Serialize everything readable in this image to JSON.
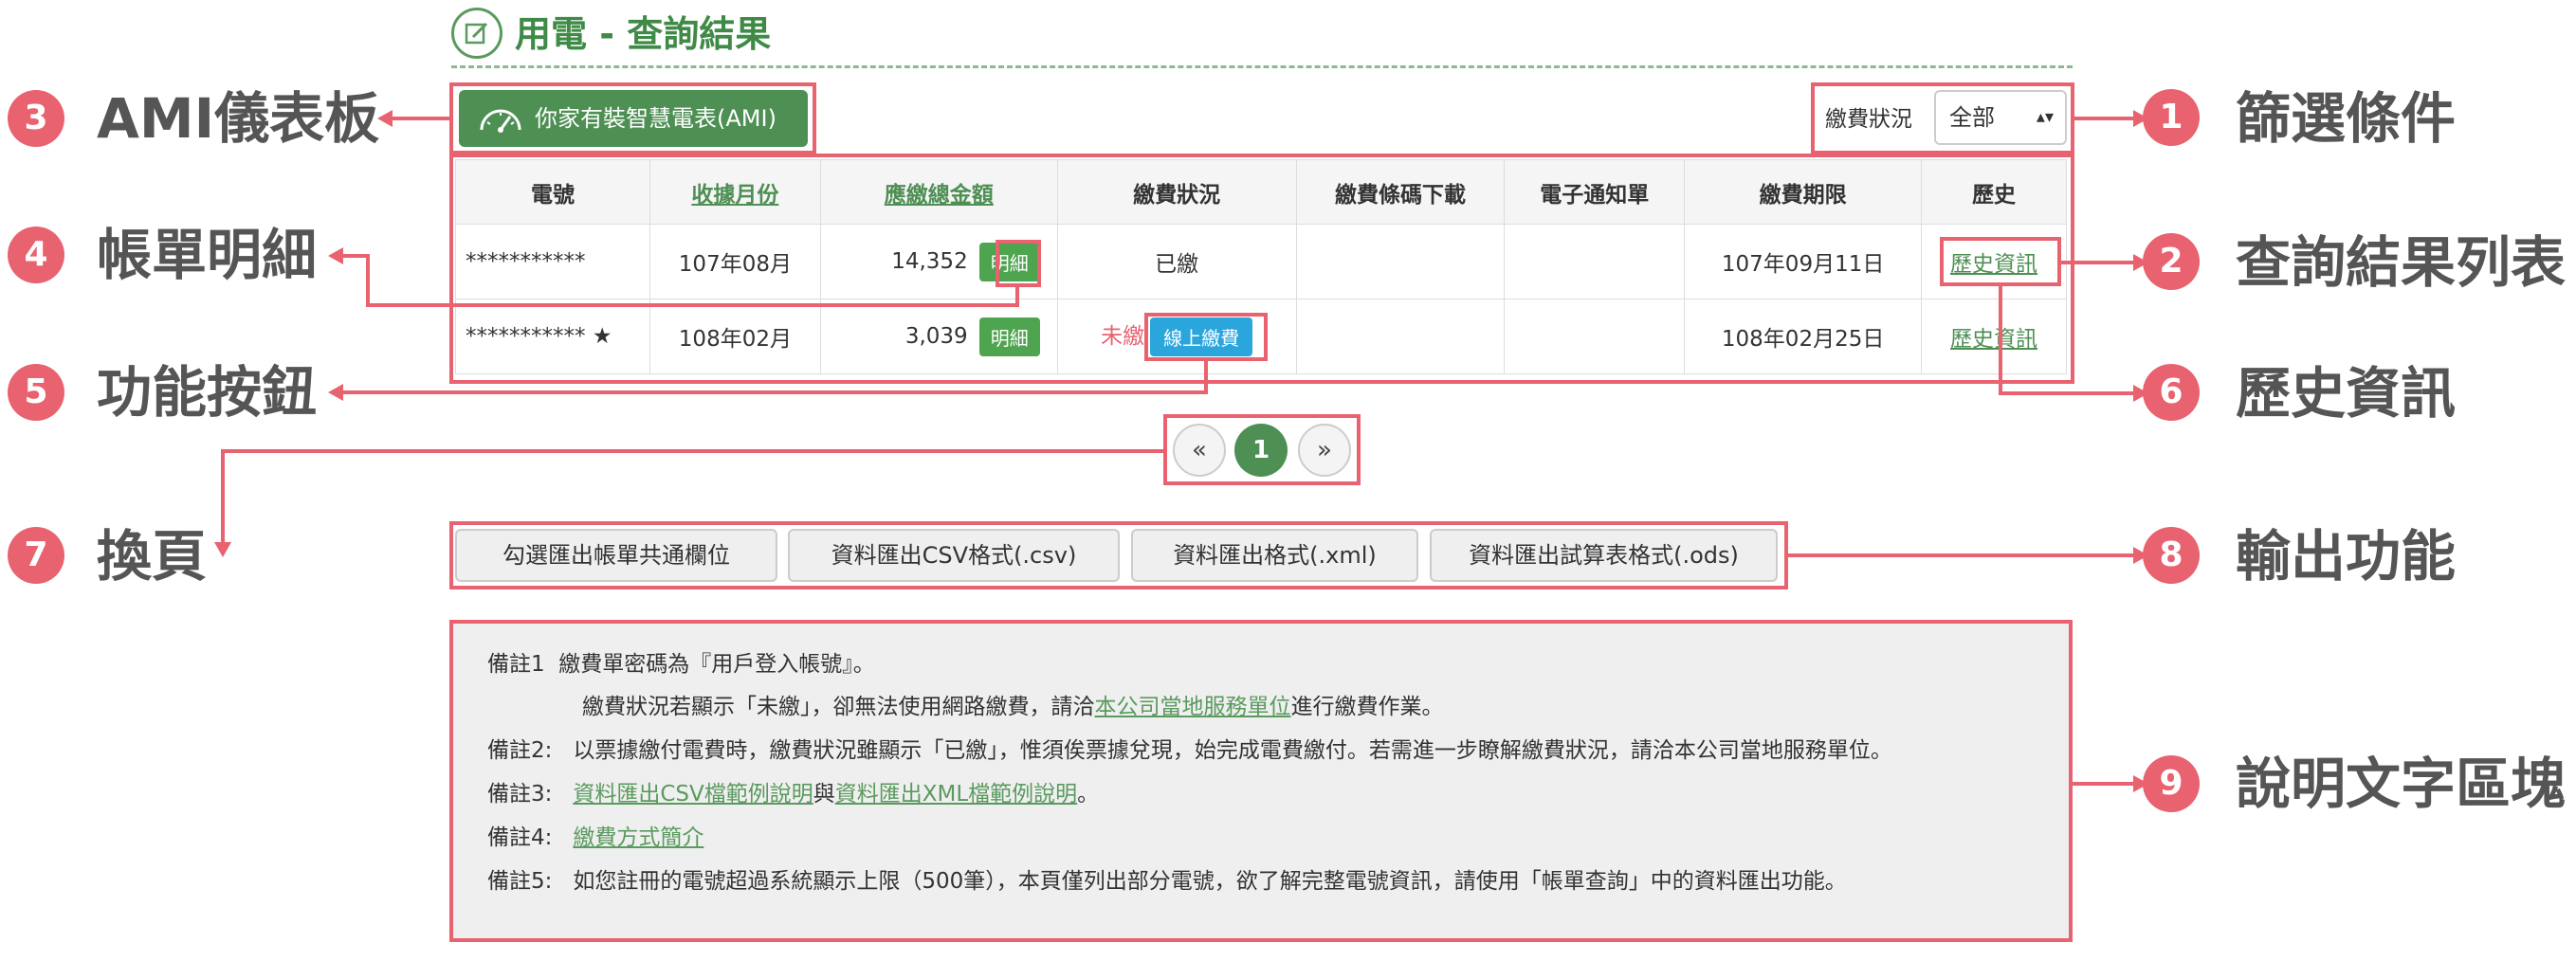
{
  "header": {
    "title": "用電 - 查詢結果",
    "icon": "edit-icon"
  },
  "ami": {
    "label": "你家有裝智慧電表(AMI)",
    "icon": "gauge-icon"
  },
  "filter": {
    "label": "繳費狀況",
    "selected": "全部",
    "caret": "▴▾"
  },
  "table": {
    "headers": [
      "電號",
      "收據月份",
      "應繳總金額",
      "繳費狀況",
      "繳費條碼下載",
      "電子通知單",
      "繳費期限",
      "歷史"
    ],
    "rows": [
      {
        "account": "***********",
        "star": "",
        "month": "107年08月",
        "amount": "14,352",
        "detail": "明細",
        "status": "已繳",
        "pay": "",
        "deadline": "107年09月11日",
        "history": "歷史資訊"
      },
      {
        "account": "***********",
        "star": "★",
        "month": "108年02月",
        "amount": "3,039",
        "detail": "明細",
        "status": "未繳",
        "pay": "線上繳費",
        "deadline": "108年02月25日",
        "history": "歷史資訊"
      }
    ]
  },
  "pagination": {
    "prev": "«",
    "current": "1",
    "next": "»"
  },
  "export": {
    "buttons": [
      "勾選匯出帳單共通欄位",
      "資料匯出CSV格式(.csv)",
      "資料匯出格式(.xml)",
      "資料匯出試算表格式(.ods)"
    ]
  },
  "notes": {
    "n1_label": "備註1",
    "n1_text": "繳費單密碼為『用戶登入帳號』。",
    "n1b_pre": "繳費狀況若顯示「未繳」，卻無法使用網路繳費，請洽",
    "n1b_link": "本公司當地服務單位",
    "n1b_post": "進行繳費作業。",
    "n2_label": "備註2:",
    "n2_text": "以票據繳付電費時，繳費狀況雖顯示「已繳」，惟須俟票據兌現，始完成電費繳付。若需進一步瞭解繳費狀況，請洽本公司當地服務單位。",
    "n3_label": "備註3:",
    "n3_link1": "資料匯出CSV檔範例說明",
    "n3_mid": "與",
    "n3_link2": "資料匯出XML檔範例說明",
    "n3_end": "。",
    "n4_label": "備註4:",
    "n4_link": "繳費方式簡介",
    "n5_label": "備註5:",
    "n5_text": "如您註冊的電號超過系統顯示上限（500筆），本頁僅列出部分電號，欲了解完整電號資訊，請使用「帳單查詢」中的資料匯出功能。"
  },
  "annotations": {
    "a1": {
      "num": "1",
      "label": "篩選條件"
    },
    "a2": {
      "num": "2",
      "label": "查詢結果列表"
    },
    "a3": {
      "num": "3",
      "label": "AMI儀表板"
    },
    "a4": {
      "num": "4",
      "label": "帳單明細"
    },
    "a5": {
      "num": "5",
      "label": "功能按鈕"
    },
    "a6": {
      "num": "6",
      "label": "歷史資訊"
    },
    "a7": {
      "num": "7",
      "label": "換頁"
    },
    "a8": {
      "num": "8",
      "label": "輸出功能"
    },
    "a9": {
      "num": "9",
      "label": "說明文字區塊"
    }
  },
  "colors": {
    "accent": "#4e8f54",
    "annotation": "#e8626f",
    "pay": "#2aa6dd"
  }
}
